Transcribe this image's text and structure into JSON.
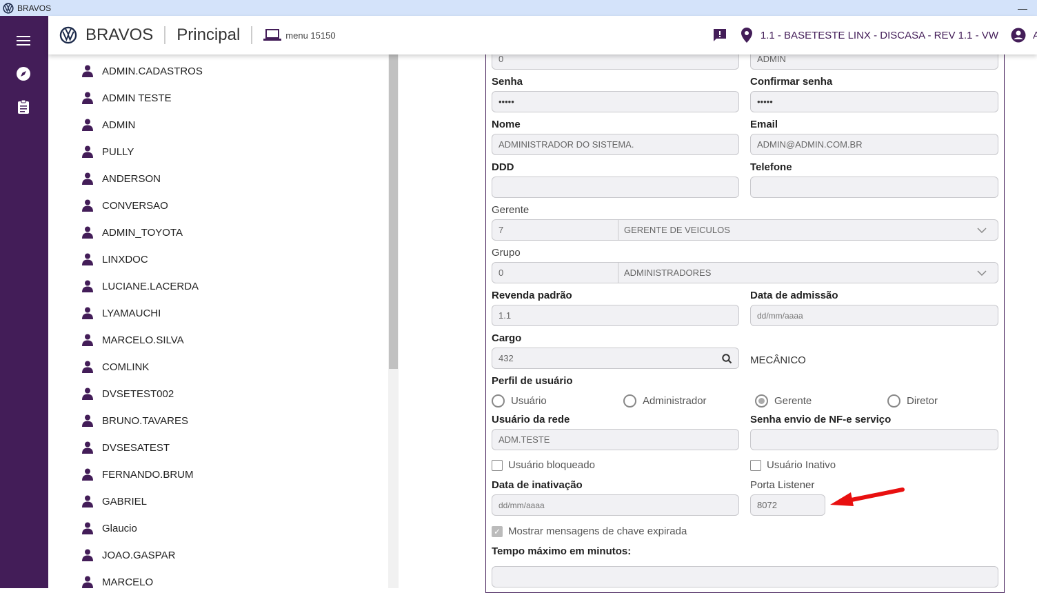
{
  "window": {
    "title": "BRAVOS",
    "minimize": "—"
  },
  "header": {
    "brand": "BRAVOS",
    "page": "Principal",
    "menu": "menu 15150",
    "location": "1.1 - BASETESTE LINX - DISCASA - REV 1.1 - VW",
    "user_initial": "A"
  },
  "users": [
    "ADMIN.CADASTROS",
    "ADMIN TESTE",
    "ADMIN",
    "PULLY",
    "ANDERSON",
    "CONVERSAO",
    "ADMIN_TOYOTA",
    "LINXDOC",
    "LUCIANE.LACERDA",
    "LYAMAUCHI",
    "MARCELO.SILVA",
    "COMLINK",
    "DVSETEST002",
    "BRUNO.TAVARES",
    "DVSESATEST",
    "FERNANDO.BRUM",
    "GABRIEL",
    "Glaucio",
    "JOAO.GASPAR",
    "MARCELO"
  ],
  "form": {
    "top_left": "0",
    "top_right": "ADMIN",
    "senha": {
      "label": "Senha",
      "value": "•••••"
    },
    "confirmar": {
      "label": "Confirmar senha",
      "value": "•••••"
    },
    "nome": {
      "label": "Nome",
      "value": "ADMINISTRADOR DO SISTEMA."
    },
    "email": {
      "label": "Email",
      "value": "ADMIN@ADMIN.COM.BR"
    },
    "ddd": {
      "label": "DDD",
      "value": ""
    },
    "telefone": {
      "label": "Telefone",
      "value": ""
    },
    "gerente": {
      "label": "Gerente",
      "code": "7",
      "value": "GERENTE DE VEICULOS"
    },
    "grupo": {
      "label": "Grupo",
      "code": "0",
      "value": "ADMINISTRADORES"
    },
    "revenda": {
      "label": "Revenda padrão",
      "value": "1.1"
    },
    "admissao": {
      "label": "Data de admissão",
      "placeholder": "dd/mm/aaaa"
    },
    "cargo": {
      "label": "Cargo",
      "value": "432",
      "description": "MECÂNICO"
    },
    "perfil": {
      "label": "Perfil de usuário",
      "options": [
        "Usuário",
        "Administrador",
        "Gerente",
        "Diretor"
      ],
      "selected": "Gerente"
    },
    "usuario_rede": {
      "label": "Usuário da rede",
      "value": "ADM.TESTE"
    },
    "senha_nfe": {
      "label": "Senha envio de NF-e serviço",
      "value": ""
    },
    "bloqueado": {
      "label": "Usuário bloqueado",
      "checked": false
    },
    "inativo": {
      "label": "Usuário Inativo",
      "checked": false
    },
    "inativacao": {
      "label": "Data de inativação",
      "placeholder": "dd/mm/aaaa"
    },
    "porta": {
      "label": "Porta Listener",
      "value": "8072"
    },
    "mostrar": {
      "label": "Mostrar mensagens de chave expirada",
      "checked": true
    },
    "tempo": {
      "label": "Tempo máximo em minutos:",
      "value": ""
    }
  },
  "colors": {
    "brand": "#431d58",
    "annotation_arrow": "#e81010"
  }
}
